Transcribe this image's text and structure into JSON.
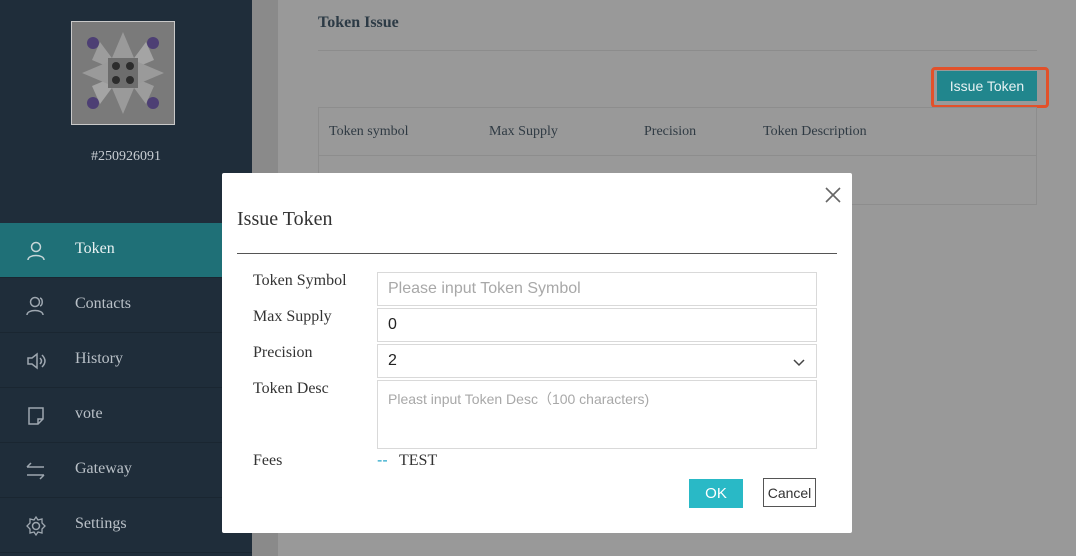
{
  "account": {
    "id": "#250926091"
  },
  "nav": {
    "items": [
      {
        "label": "Token",
        "icon": "user-icon",
        "active": true
      },
      {
        "label": "Contacts",
        "icon": "contacts-icon"
      },
      {
        "label": "History",
        "icon": "speaker-icon"
      },
      {
        "label": "vote",
        "icon": "note-icon"
      },
      {
        "label": "Gateway",
        "icon": "transfer-icon"
      },
      {
        "label": "Settings",
        "icon": "gear-icon"
      }
    ],
    "collapse_glyph": "‹"
  },
  "page": {
    "title": "Token Issue",
    "issue_button": "Issue Token",
    "table": {
      "columns": [
        "Token symbol",
        "Max Supply",
        "Precision",
        "Token Description"
      ]
    }
  },
  "modal": {
    "title": "Issue Token",
    "fields": {
      "symbol_label": "Token Symbol",
      "symbol_placeholder": "Please input Token Symbol",
      "max_supply_label": "Max Supply",
      "max_supply_value": "0",
      "precision_label": "Precision",
      "precision_value": "2",
      "desc_label": "Token Desc",
      "desc_placeholder": "Pleast input Token Desc（100 characters)",
      "fees_label": "Fees",
      "fees_value": "--",
      "fees_unit": "TEST"
    },
    "ok_label": "OK",
    "cancel_label": "Cancel"
  },
  "colors": {
    "sidebar_bg": "#1f2d3a",
    "active_nav": "#1f7077",
    "accent": "#29b9c6",
    "highlight": "#e2512a"
  }
}
